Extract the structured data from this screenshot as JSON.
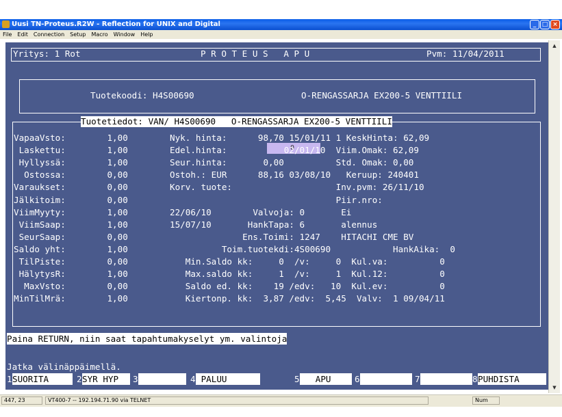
{
  "window": {
    "title": "Uusi TN-Proteus.R2W - Reflection for UNIX and Digital"
  },
  "menu": [
    "File",
    "Edit",
    "Connection",
    "Setup",
    "Macro",
    "Window",
    "Help"
  ],
  "header": {
    "company": "Yritys: 1 Rot",
    "title": "P R O T E U S   A P U",
    "date": "Pvm: 11/04/2011"
  },
  "product": {
    "code_line": "Tuotekoodi: H4S00690",
    "name": "O-RENGASSARJA EX200-5 VENTTIILI"
  },
  "details_title": "Tuotetiedot: VAN/ H4S00690   O-RENGASSARJA EX200-5 VENTTIILI",
  "rows": [
    {
      "c1": "VapaaVsto:        1,00",
      "c2": "Nyk. hinta:      98,70 15/01/11 1 KeskHinta: 62,09"
    },
    {
      "c1": " Laskettu:        1,00",
      "c2": "Edel.hinta:           02/01/10  Viim.Omak: 62,09"
    },
    {
      "c1": " Hyllyssä:        1,00",
      "c2": "Seur.hinta:       0,00          Std. Omak: 0,00"
    },
    {
      "c1": "  Ostossa:        0,00",
      "c2": "Ostoh.: EUR      88,16 03/08/10   Keruup: 240401"
    },
    {
      "c1": "Varaukset:        0,00",
      "c2": "Korv. tuote:                    Inv.pvm: 26/11/10"
    },
    {
      "c1": "Jälkitoim:        0,00",
      "c2": "                                Piir.nro:"
    },
    {
      "c1": "ViimMyyty:        1,00",
      "c2": "22/06/10        Valvoja: 0       Ei"
    },
    {
      "c1": " ViimSaap:        1,00",
      "c2": "15/07/10       HankTapa: 6       alennus"
    },
    {
      "c1": " SeurSaap:        0,00",
      "c2": "              Ens.Toimi: 1247    HITACHI CME BV"
    },
    {
      "c1": "Saldo yht:        1,00",
      "c2": "          Toim.tuotekdi:4S00690            HankAika:  0"
    },
    {
      "c1": " TilPiste:        0,00",
      "c2": "   Min.Saldo kk:     0  /v:     0  Kul.va:          0"
    },
    {
      "c1": " HälytysR:        1,00",
      "c2": "   Max.saldo kk:     1  /v:     1  Kul.12:          0"
    },
    {
      "c1": "  MaxVsto:        0,00",
      "c2": "   Saldo ed. kk:    19 /edv:   10  Kul.ev:          0"
    },
    {
      "c1": "MinTilMrä:        1,00",
      "c2": "   Kiertonp. kk:  3,87 /edv:  5,45  Valv:  1 09/04/11"
    }
  ],
  "edit_field": {
    "value": "0"
  },
  "prompt": "Paina RETURN, niin saat tapahtumakyselyt ym. valintoja",
  "continue": "Jatka välinäppäimellä.",
  "fkeys": [
    {
      "num": "1",
      "label": "SUORITA"
    },
    {
      "num": "2",
      "label": "SYR HYP"
    },
    {
      "num": "3",
      "label": ""
    },
    {
      "num": "4",
      "label": " PALUU"
    },
    {
      "num": "5",
      "label": "   APU"
    },
    {
      "num": "6",
      "label": ""
    },
    {
      "num": "7",
      "label": ""
    },
    {
      "num": "8",
      "label": "PUHDISTA"
    }
  ],
  "status": {
    "cursor": "447, 23",
    "connection": "VT400-7 -- 192.194.71.90 via TELNET",
    "num": "Num"
  }
}
